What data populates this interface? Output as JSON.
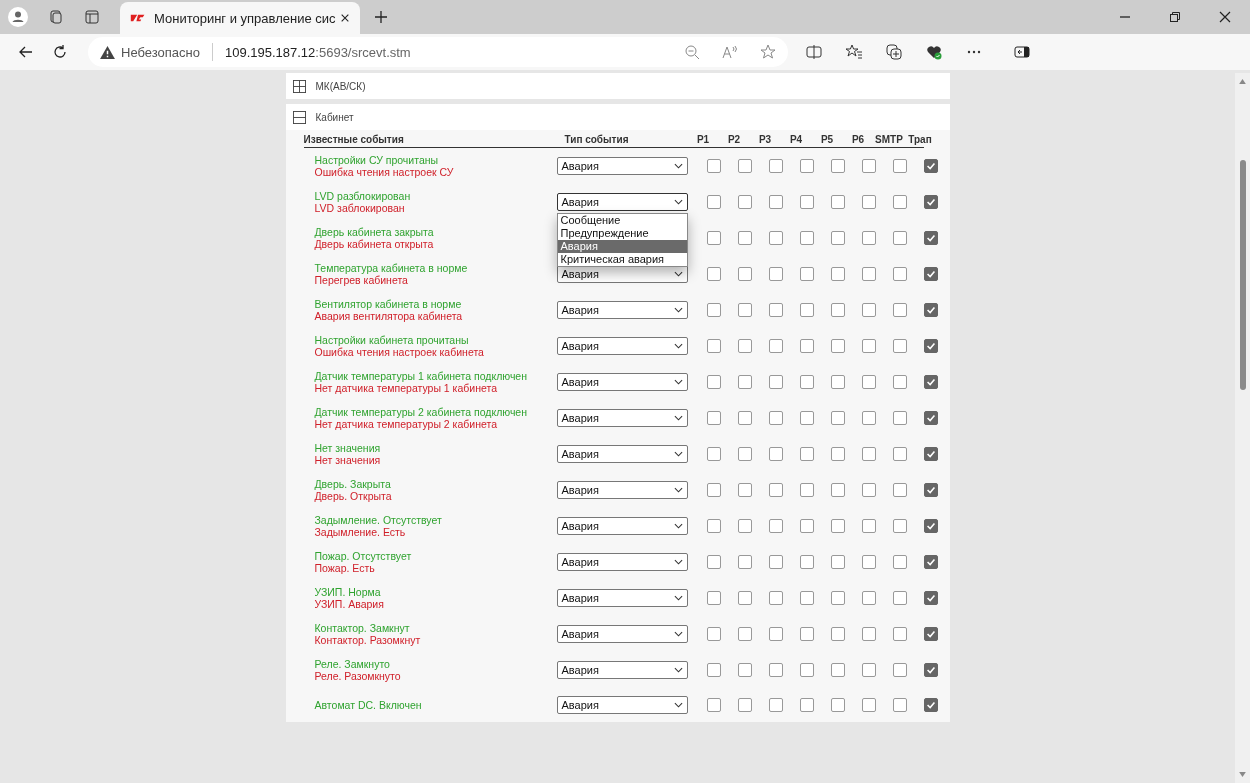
{
  "browser": {
    "tab": {
      "title": "Мониторинг и управление сис",
      "selected": true
    },
    "address": {
      "security": "Небезопасно",
      "host": "109.195.187.12",
      "path": ":5693/srcevt.stm"
    }
  },
  "sections": [
    {
      "title": "МК(АВ/СК)",
      "expanded": false
    },
    {
      "title": "Кабинет",
      "expanded": true
    }
  ],
  "table": {
    "columns": [
      "Известные события",
      "Тип события",
      "P1",
      "P2",
      "P3",
      "P4",
      "P5",
      "P6",
      "SMTP",
      "Трап"
    ],
    "rows": [
      {
        "ok": "Настройки СУ прочитаны",
        "fail": "Ошибка чтения настроек СУ",
        "type": "Авария",
        "flags": [
          false,
          false,
          false,
          false,
          false,
          false,
          false,
          true
        ]
      },
      {
        "ok": "LVD разблокирован",
        "fail": "LVD заблокирован",
        "type": "Авария",
        "flags": [
          false,
          false,
          false,
          false,
          false,
          false,
          false,
          true
        ],
        "open": true
      },
      {
        "ok": "Дверь кабинета закрыта",
        "fail": "Дверь кабинета открыта",
        "flags": [
          false,
          false,
          false,
          false,
          false,
          false,
          false,
          true
        ]
      },
      {
        "ok": "Температура кабинета в норме",
        "fail": "Перегрев кабинета",
        "type": "Авария",
        "flags": [
          false,
          false,
          false,
          false,
          false,
          false,
          false,
          true
        ]
      },
      {
        "ok": "Вентилятор кабинета в норме",
        "fail": "Авария вентилятора кабинета",
        "type": "Авария",
        "flags": [
          false,
          false,
          false,
          false,
          false,
          false,
          false,
          true
        ]
      },
      {
        "ok": "Настройки кабинета прочитаны",
        "fail": "Ошибка чтения настроек кабинета",
        "type": "Авария",
        "flags": [
          false,
          false,
          false,
          false,
          false,
          false,
          false,
          true
        ]
      },
      {
        "ok": "Датчик температуры 1 кабинета подключен",
        "fail": "Нет датчика температуры 1 кабинета",
        "type": "Авария",
        "flags": [
          false,
          false,
          false,
          false,
          false,
          false,
          false,
          true
        ]
      },
      {
        "ok": "Датчик температуры 2 кабинета подключен",
        "fail": "Нет датчика температуры 2 кабинета",
        "type": "Авария",
        "flags": [
          false,
          false,
          false,
          false,
          false,
          false,
          false,
          true
        ]
      },
      {
        "ok": "Нет значения",
        "fail": "Нет значения",
        "type": "Авария",
        "flags": [
          false,
          false,
          false,
          false,
          false,
          false,
          false,
          true
        ]
      },
      {
        "ok": "Дверь. Закрыта",
        "fail": "Дверь. Открыта",
        "type": "Авария",
        "flags": [
          false,
          false,
          false,
          false,
          false,
          false,
          false,
          true
        ]
      },
      {
        "ok": "Задымление. Отсутствует",
        "fail": "Задымление. Есть",
        "type": "Авария",
        "flags": [
          false,
          false,
          false,
          false,
          false,
          false,
          false,
          true
        ]
      },
      {
        "ok": "Пожар. Отсутствует",
        "fail": "Пожар. Есть",
        "type": "Авария",
        "flags": [
          false,
          false,
          false,
          false,
          false,
          false,
          false,
          true
        ]
      },
      {
        "ok": "УЗИП. Норма",
        "fail": "УЗИП. Авария",
        "type": "Авария",
        "flags": [
          false,
          false,
          false,
          false,
          false,
          false,
          false,
          true
        ]
      },
      {
        "ok": "Контактор. Замкнут",
        "fail": "Контактор. Разомкнут",
        "type": "Авария",
        "flags": [
          false,
          false,
          false,
          false,
          false,
          false,
          false,
          true
        ]
      },
      {
        "ok": "Реле. Замкнуто",
        "fail": "Реле. Разомкнуто",
        "type": "Авария",
        "flags": [
          false,
          false,
          false,
          false,
          false,
          false,
          false,
          true
        ]
      },
      {
        "ok": "Автомат DC. Включен",
        "type": "Авария",
        "flags": [
          false,
          false,
          false,
          false,
          false,
          false,
          false,
          true
        ]
      }
    ]
  },
  "dropdown": {
    "options": [
      {
        "label": "Сообщение",
        "selected": false
      },
      {
        "label": "Предупреждение",
        "selected": false
      },
      {
        "label": "Авария",
        "selected": true
      },
      {
        "label": "Критическая авария",
        "selected": false
      }
    ]
  }
}
